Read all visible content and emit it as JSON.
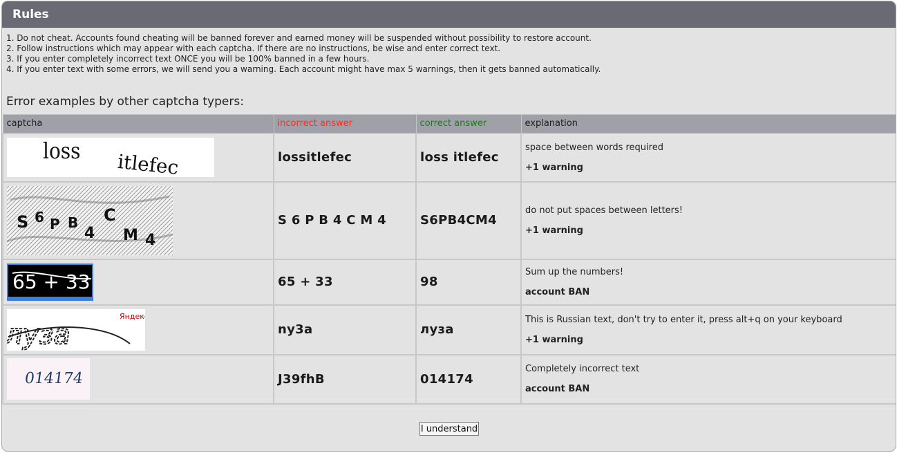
{
  "header": {
    "title": "Rules"
  },
  "rules": [
    "1. Do not cheat. Accounts found cheating will be banned forever and earned money will be suspended without possibility to restore account.",
    "2. Follow instructions which may appear with each captcha. If there are no instructions, be wise and enter correct text.",
    "3. If you enter completely incorrect text ONCE you will be 100% banned in a few hours.",
    "4. If you enter text with some errors, we will send you a warning. Each account might have max 5 warnings, then it gets banned automatically."
  ],
  "examples_title": "Error examples by other captcha typers:",
  "table": {
    "headers": {
      "captcha": "captcha",
      "incorrect": "incorrect answer",
      "correct": "correct answer",
      "explanation": "explanation"
    },
    "colors": {
      "incorrect": "#ff2a1a",
      "correct": "#1b7a1b",
      "header_bg": "#a0a1a8"
    },
    "rows": [
      {
        "captcha_text": "loss itlefec",
        "incorrect": "lossitlefec",
        "correct": "loss itlefec",
        "explanation": "space between words required",
        "penalty": "+1 warning"
      },
      {
        "captcha_text": "S6PB4CM4",
        "incorrect": "S 6 P B 4 C M 4",
        "correct": "S6PB4CM4",
        "explanation": "do not put spaces between letters!",
        "penalty": "+1 warning"
      },
      {
        "captcha_text": "65 + 33",
        "incorrect": "65 + 33",
        "correct": "98",
        "explanation": "Sum up the numbers!",
        "penalty": "account BAN"
      },
      {
        "captcha_text": "луза",
        "captcha_brand": "Яндекс",
        "incorrect": "ny3a",
        "correct": "луза",
        "explanation": "This is Russian text, don't try to enter it, press alt+q on your keyboard",
        "penalty": "+1 warning"
      },
      {
        "captcha_text": "014174",
        "incorrect": "J39fhB",
        "correct": "014174",
        "explanation": "Completely incorrect text",
        "penalty": "account BAN"
      }
    ]
  },
  "footer": {
    "button_label": "I understand"
  }
}
